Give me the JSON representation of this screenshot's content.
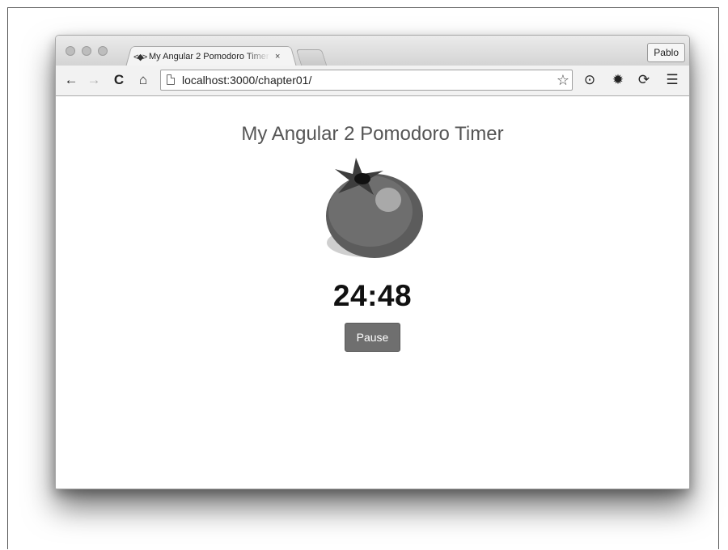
{
  "browser": {
    "tab": {
      "favicon": "angular-icon",
      "title": "My Angular 2 Pomodoro Timer",
      "close": "×"
    },
    "profile_name": "Pablo",
    "toolbar": {
      "back": "←",
      "forward": "→",
      "reload": "C",
      "home": "⌂",
      "url": "localhost:3000/chapter01/",
      "star": "☆",
      "extension1": "⊙",
      "settings": "✹",
      "extension2": "⟳",
      "menu": "☰"
    }
  },
  "page": {
    "title": "My Angular 2 Pomodoro Timer",
    "tomato_icon": "tomato-icon",
    "timer": "24:48",
    "pause_label": "Pause"
  }
}
